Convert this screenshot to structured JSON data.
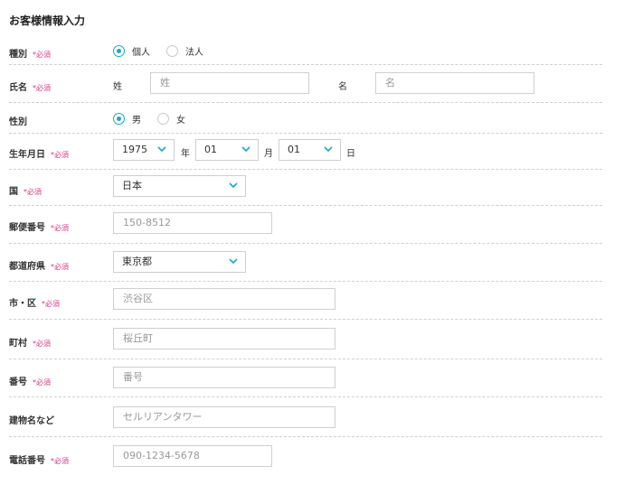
{
  "section_title": "お客様情報入力",
  "required_mark": "*必須",
  "contract_type": {
    "label": "種別",
    "options": [
      "個人",
      "法人"
    ],
    "selected": "個人"
  },
  "name": {
    "label": "氏名",
    "last_label": "姓",
    "last_placeholder": "姓",
    "first_label": "名",
    "first_placeholder": "名"
  },
  "gender": {
    "label": "性別",
    "options": [
      "男",
      "女"
    ],
    "selected": "男"
  },
  "birthdate": {
    "label": "生年月日",
    "year": "1975",
    "year_unit": "年",
    "month": "01",
    "month_unit": "月",
    "day": "01",
    "day_unit": "日"
  },
  "country": {
    "label": "国",
    "value": "日本"
  },
  "postal": {
    "label": "郵便番号",
    "placeholder": "150-8512"
  },
  "prefecture": {
    "label": "都道府県",
    "value": "東京都"
  },
  "city": {
    "label": "市・区",
    "placeholder": "渋谷区"
  },
  "town": {
    "label": "町村",
    "placeholder": "桜丘町"
  },
  "address_number": {
    "label": "番号",
    "placeholder": "番号"
  },
  "building": {
    "label": "建物名など",
    "placeholder": "セルリアンタワー"
  },
  "phone": {
    "label": "電話番号",
    "placeholder": "090-1234-5678"
  },
  "colors": {
    "accent": "#1aa7c9",
    "required": "#d4378a",
    "border": "#cfcfcf",
    "divider": "#cfcfcf"
  }
}
